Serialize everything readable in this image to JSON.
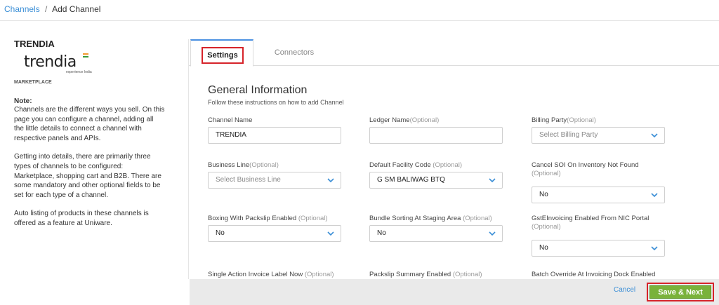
{
  "breadcrumb": {
    "parent": "Channels",
    "separator": "/",
    "current": "Add Channel"
  },
  "channel": {
    "title": "TRENDIA",
    "logo_text": "trendia",
    "logo_subtext": "experience India",
    "type": "MARKETPLACE"
  },
  "note": {
    "heading": "Note:",
    "paragraphs": [
      "Channels are the different ways you sell. On this page you can configure a channel, adding all the little details to connect a channel with respective panels and APIs.",
      "Getting into details, there are primarily three types of channels to be configured: Marketplace, shopping cart and B2B. There are some mandatory and other optional fields to be set for each type of a channel.",
      "Auto listing of products in these channels is offered as a feature at Uniware."
    ]
  },
  "tabs": {
    "settings": "Settings",
    "connectors": "Connectors"
  },
  "section": {
    "title": "General Information",
    "subtitle": "Follow these instructions on how to add Channel"
  },
  "fields": [
    {
      "label": "Channel Name",
      "optional": "",
      "value": "TRENDIA",
      "placeholder": "",
      "kind": "input"
    },
    {
      "label": "Ledger Name",
      "optional": "(Optional)",
      "value": "",
      "placeholder": "",
      "kind": "input"
    },
    {
      "label": "Billing Party",
      "optional": "(Optional)",
      "value": "",
      "placeholder": "Select Billing Party",
      "kind": "select"
    },
    {
      "label": "Business Line",
      "optional": "(Optional)",
      "value": "",
      "placeholder": "Select Business Line",
      "kind": "select"
    },
    {
      "label": "Default Facility Code ",
      "optional": "(Optional)",
      "value": "G SM BALIWAG BTQ",
      "placeholder": "",
      "kind": "select"
    },
    {
      "label": "Cancel SOI On Inventory Not Found ",
      "optional": "(Optional)",
      "value": "No",
      "placeholder": "",
      "kind": "select"
    },
    {
      "label": "Boxing With Packslip Enabled ",
      "optional": "(Optional)",
      "value": "No",
      "placeholder": "",
      "kind": "select"
    },
    {
      "label": "Bundle Sorting At Staging Area ",
      "optional": "(Optional)",
      "value": "No",
      "placeholder": "",
      "kind": "select"
    },
    {
      "label": "GstEInvoicing Enabled From NIC Portal ",
      "optional": "(Optional)",
      "value": "No",
      "placeholder": "",
      "kind": "select"
    },
    {
      "label": "Single Action Invoice Label Now ",
      "optional": "(Optional)",
      "value": "",
      "placeholder": "",
      "kind": "select"
    },
    {
      "label": "Packslip Summary Enabled ",
      "optional": "(Optional)",
      "value": "",
      "placeholder": "",
      "kind": "select"
    },
    {
      "label": "Batch Override At Invoicing Dock Enabled",
      "optional": "",
      "value": "",
      "placeholder": "",
      "kind": "select"
    }
  ],
  "footer": {
    "cancel": "Cancel",
    "save": "Save & Next"
  },
  "colors": {
    "accent": "#3a8ed6",
    "save_green": "#79b23a",
    "highlight_red": "#d6232a"
  }
}
